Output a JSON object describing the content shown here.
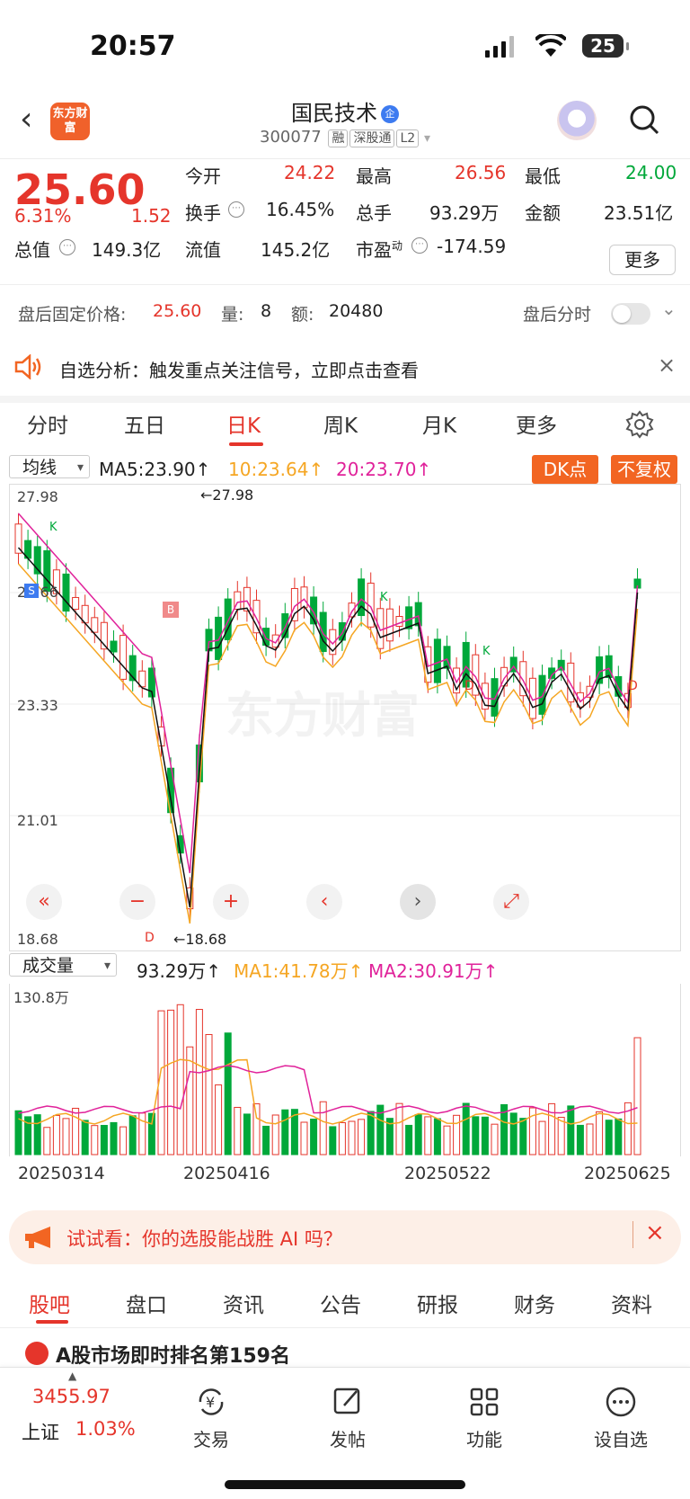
{
  "status": {
    "time": "20:57",
    "battery": "25"
  },
  "header": {
    "logo_text": "东方财富",
    "name": "国民技术",
    "qi_badge": "企",
    "code": "300077",
    "tags": [
      "融",
      "深股通",
      "L2"
    ]
  },
  "quote": {
    "price": "25.60",
    "change_pct": "6.31%",
    "change": "1.52",
    "open_label": "今开",
    "open": "24.22",
    "high_label": "最高",
    "high": "26.56",
    "low_label": "最低",
    "low": "24.00",
    "turnover_label": "换手",
    "turnover": "16.45%",
    "volume_label": "总手",
    "volume": "93.29万",
    "amount_label": "金额",
    "amount": "23.51亿",
    "mktcap_label": "总值",
    "mktcap": "149.3亿",
    "float_label": "流值",
    "float": "145.2亿",
    "pe_label": "市盈",
    "pe_sup": "动",
    "pe": "-174.59",
    "more": "更多"
  },
  "after_hours": {
    "label": "盘后固定价格:",
    "price": "25.60",
    "qty_label": "量:",
    "qty": "8",
    "amt_label": "额:",
    "amt": "20480",
    "chart_label": "盘后分时"
  },
  "alert": {
    "text": "自选分析：触发重点关注信号，立即点击查看"
  },
  "tabs": [
    "分时",
    "五日",
    "日K",
    "周K",
    "月K",
    "更多"
  ],
  "active_tab": "日K",
  "ma": {
    "selector": "均线",
    "ma5": "MA5:23.90",
    "ma10": "10:23.64",
    "ma20": "20:23.70",
    "dk_button": "DK点",
    "adjust_button": "不复权"
  },
  "kline": {
    "y_labels": [
      "27.98",
      "25.66",
      "23.33",
      "21.01",
      "18.68"
    ],
    "max_label": "←27.98",
    "min_label": "←18.68",
    "markers": [
      "K",
      "S",
      "B",
      "D",
      "K",
      "D",
      "K",
      "D"
    ],
    "watermark": "东方财富",
    "colors": {
      "up": "#e5352b",
      "down": "#00a83a",
      "ma5": "#111111",
      "ma10": "#f5a623",
      "ma20": "#e0229a"
    }
  },
  "volume": {
    "selector": "成交量",
    "vol": "93.29万",
    "ma1": "MA1:41.78万",
    "ma2": "MA2:30.91万",
    "max_label": "130.8万"
  },
  "dates": [
    "20250314",
    "20250416",
    "20250522",
    "20250625"
  ],
  "ai_bar": {
    "text": "试试看：你的选股能战胜 AI 吗？"
  },
  "bottom_tabs": [
    "股吧",
    "盘口",
    "资讯",
    "公告",
    "研报",
    "财务",
    "资料"
  ],
  "rank_text": "A股市场即时排名第159名",
  "index": {
    "value": "3455.97",
    "name": "上证",
    "pct": "1.03%"
  },
  "bottom_nav": [
    "交易",
    "发帖",
    "功能",
    "设自选"
  ]
}
